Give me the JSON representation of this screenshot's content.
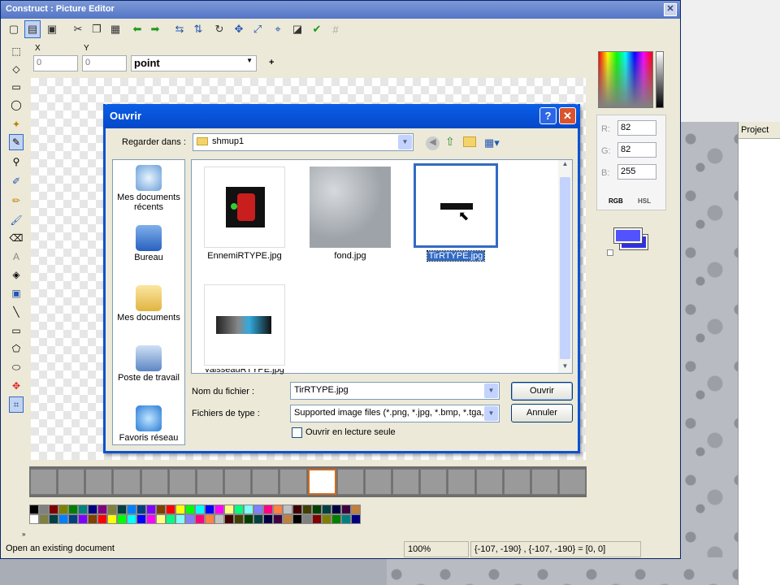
{
  "window": {
    "title": "Construct : Picture Editor",
    "close": "✕"
  },
  "toolbar": {
    "x_label": "X",
    "y_label": "Y",
    "x_value": "0",
    "y_value": "0",
    "shape_value": "point",
    "plus": "+"
  },
  "dialog": {
    "title": "Ouvrir",
    "help": "?",
    "close": "✕",
    "look_in_label": "Regarder dans :",
    "look_in_value": "shmup1",
    "places": [
      {
        "label": "Mes documents récents"
      },
      {
        "label": "Bureau"
      },
      {
        "label": "Mes documents"
      },
      {
        "label": "Poste de travail"
      },
      {
        "label": "Favoris réseau"
      }
    ],
    "files": [
      {
        "name": "EnnemiRTYPE.jpg"
      },
      {
        "name": "fond.jpg"
      },
      {
        "name": "TirRTYPE.jpg"
      },
      {
        "name": "vaisseauRTYPE.jpg"
      }
    ],
    "filename_label": "Nom du fichier :",
    "filename_value": "TirRTYPE.jpg",
    "filetype_label": "Fichiers de type :",
    "filetype_value": "Supported image files (*.png, *.jpg, *.bmp, *.tga,",
    "readonly_label": "Ouvrir en lecture seule",
    "open_button": "Ouvrir",
    "cancel_button": "Annuler"
  },
  "color": {
    "r_label": "R:",
    "g_label": "G:",
    "b_label": "B:",
    "r": "82",
    "g": "82",
    "b": "255",
    "tab_rgb": "RGB",
    "tab_hsl": "HSL",
    "current": "#5252ff"
  },
  "project": {
    "title": "Project"
  },
  "status": {
    "message": "Open an existing document",
    "zoom": "100%",
    "coords": "{-107, -190} , {-107, -190} = [0, 0]"
  }
}
